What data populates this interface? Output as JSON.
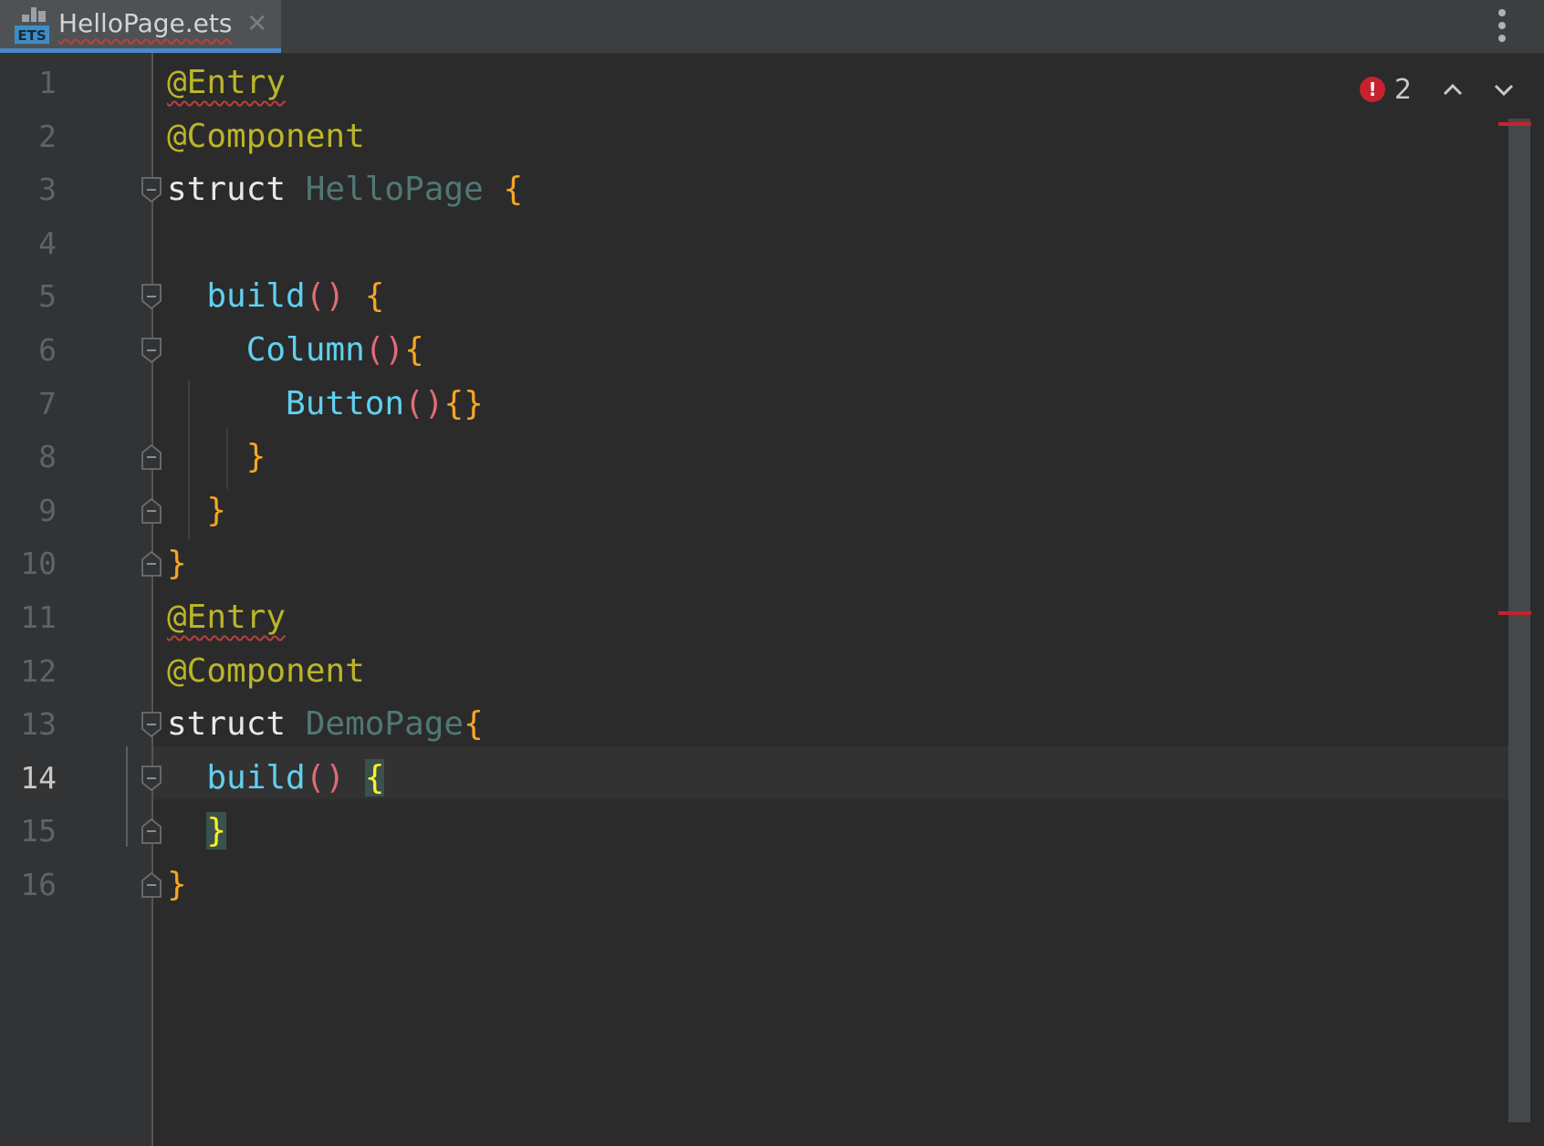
{
  "tab": {
    "icon_label": "ETS",
    "title": "HelloPage.ets",
    "close_glyph": "✕"
  },
  "editor": {
    "current_line": 14,
    "line_numbers": [
      "1",
      "2",
      "3",
      "4",
      "5",
      "6",
      "7",
      "8",
      "9",
      "10",
      "11",
      "12",
      "13",
      "14",
      "15",
      "16"
    ],
    "lines": [
      [
        {
          "t": "@Entry",
          "c": "ann squiggle"
        }
      ],
      [
        {
          "t": "@Component",
          "c": "ann"
        }
      ],
      [
        {
          "t": "struct ",
          "c": "kw"
        },
        {
          "t": "HelloPage",
          "c": "tn"
        },
        {
          "t": " ",
          "c": ""
        },
        {
          "t": "{",
          "c": "br"
        }
      ],
      [],
      [
        {
          "t": "  ",
          "c": ""
        },
        {
          "t": "build",
          "c": "fn"
        },
        {
          "t": "()",
          "c": "par"
        },
        {
          "t": " ",
          "c": ""
        },
        {
          "t": "{",
          "c": "br"
        }
      ],
      [
        {
          "t": "    ",
          "c": ""
        },
        {
          "t": "Column",
          "c": "fn"
        },
        {
          "t": "()",
          "c": "par"
        },
        {
          "t": "{",
          "c": "br"
        }
      ],
      [
        {
          "t": "      ",
          "c": ""
        },
        {
          "t": "Button",
          "c": "fn"
        },
        {
          "t": "()",
          "c": "par"
        },
        {
          "t": "{}",
          "c": "br"
        }
      ],
      [
        {
          "t": "    ",
          "c": ""
        },
        {
          "t": "}",
          "c": "br"
        }
      ],
      [
        {
          "t": "  ",
          "c": ""
        },
        {
          "t": "}",
          "c": "br"
        }
      ],
      [
        {
          "t": "}",
          "c": "br"
        }
      ],
      [
        {
          "t": "@Entry",
          "c": "ann squiggle"
        }
      ],
      [
        {
          "t": "@Component",
          "c": "ann"
        }
      ],
      [
        {
          "t": "struct ",
          "c": "kw"
        },
        {
          "t": "DemoPage",
          "c": "tn"
        },
        {
          "t": "{",
          "c": "br"
        }
      ],
      [
        {
          "t": "  ",
          "c": ""
        },
        {
          "t": "build",
          "c": "fn"
        },
        {
          "t": "()",
          "c": "par"
        },
        {
          "t": " ",
          "c": ""
        },
        {
          "t": "{",
          "c": "br-match"
        }
      ],
      [
        {
          "t": "  ",
          "c": ""
        },
        {
          "t": "}",
          "c": "br-match"
        }
      ],
      [
        {
          "t": "}",
          "c": "br"
        }
      ]
    ]
  },
  "inspection": {
    "error_glyph": "!",
    "error_count": "2"
  },
  "colors": {
    "background": "#2b2b2b",
    "annotation": "#bbb529",
    "function": "#61d0f0",
    "brace": "#f5a623",
    "error": "#c7222d",
    "tab_accent": "#4a88c7"
  }
}
